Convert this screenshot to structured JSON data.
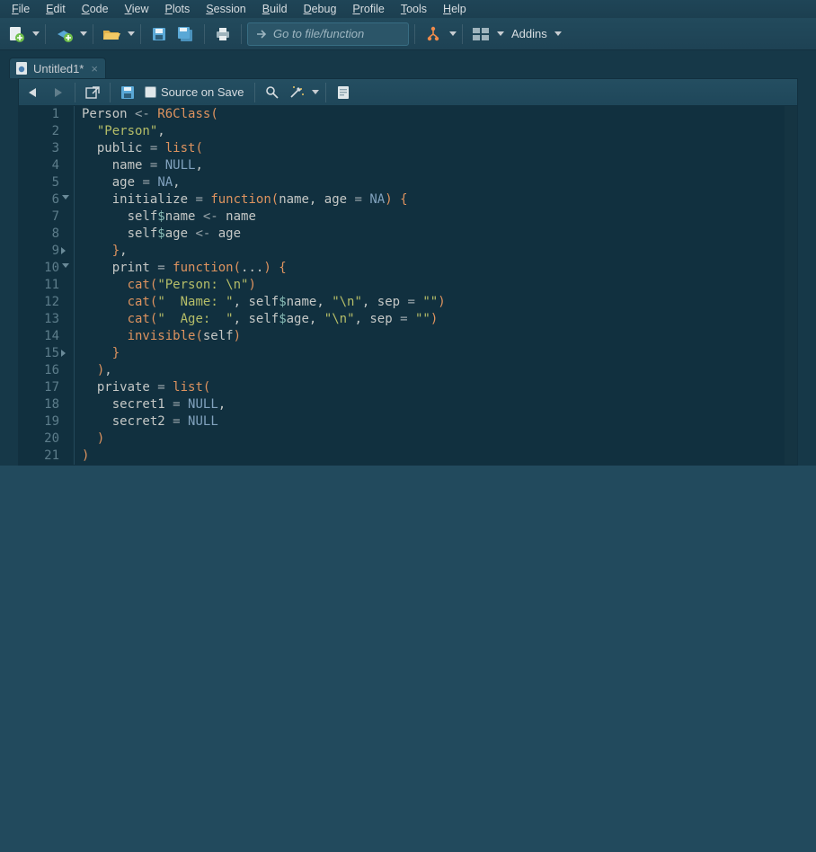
{
  "menubar": [
    {
      "label": "File",
      "ul": "F"
    },
    {
      "label": "Edit",
      "ul": "E"
    },
    {
      "label": "Code",
      "ul": "C"
    },
    {
      "label": "View",
      "ul": "V"
    },
    {
      "label": "Plots",
      "ul": "P"
    },
    {
      "label": "Session",
      "ul": "S"
    },
    {
      "label": "Build",
      "ul": "B"
    },
    {
      "label": "Debug",
      "ul": "D"
    },
    {
      "label": "Profile",
      "ul": "P"
    },
    {
      "label": "Tools",
      "ul": "T"
    },
    {
      "label": "Help",
      "ul": "H"
    }
  ],
  "toolbar": {
    "goto_placeholder": "Go to file/function",
    "addins_label": "Addins"
  },
  "tab": {
    "title": "Untitled1*"
  },
  "editor_toolbar": {
    "source_on_save": "Source on Save"
  },
  "gutter": {
    "lines": [
      1,
      2,
      3,
      4,
      5,
      6,
      7,
      8,
      9,
      10,
      11,
      12,
      13,
      14,
      15,
      16,
      17,
      18,
      19,
      20,
      21
    ],
    "fold_open_at": [
      6,
      10
    ],
    "fold_close_at": [
      9,
      15
    ]
  },
  "code": {
    "lines": [
      [
        [
          "id",
          "Person"
        ],
        [
          "op",
          " <- "
        ],
        [
          "fun",
          "R6Class"
        ],
        [
          "p",
          "("
        ]
      ],
      [
        [
          "sp",
          "  "
        ],
        [
          "str",
          "\"Person\""
        ],
        [
          "pun",
          ","
        ]
      ],
      [
        [
          "sp",
          "  "
        ],
        [
          "id",
          "public"
        ],
        [
          "op",
          " = "
        ],
        [
          "fun",
          "list"
        ],
        [
          "p",
          "("
        ]
      ],
      [
        [
          "sp",
          "    "
        ],
        [
          "id",
          "name"
        ],
        [
          "op",
          " = "
        ],
        [
          "con",
          "NULL"
        ],
        [
          "pun",
          ","
        ]
      ],
      [
        [
          "sp",
          "    "
        ],
        [
          "id",
          "age"
        ],
        [
          "op",
          " = "
        ],
        [
          "con",
          "NA"
        ],
        [
          "pun",
          ","
        ]
      ],
      [
        [
          "sp",
          "    "
        ],
        [
          "id",
          "initialize"
        ],
        [
          "op",
          " = "
        ],
        [
          "fun",
          "function"
        ],
        [
          "p",
          "("
        ],
        [
          "id",
          "name"
        ],
        [
          "pun",
          ", "
        ],
        [
          "id",
          "age"
        ],
        [
          "op",
          " = "
        ],
        [
          "con",
          "NA"
        ],
        [
          "p",
          ")"
        ],
        [
          "op",
          " "
        ],
        [
          "p",
          "{"
        ]
      ],
      [
        [
          "sp",
          "      "
        ],
        [
          "id",
          "self"
        ],
        [
          "dollar",
          "$"
        ],
        [
          "id",
          "name"
        ],
        [
          "op",
          " <- "
        ],
        [
          "id",
          "name"
        ]
      ],
      [
        [
          "sp",
          "      "
        ],
        [
          "id",
          "self"
        ],
        [
          "dollar",
          "$"
        ],
        [
          "id",
          "age"
        ],
        [
          "op",
          " <- "
        ],
        [
          "id",
          "age"
        ]
      ],
      [
        [
          "sp",
          "    "
        ],
        [
          "p",
          "}"
        ],
        [
          "pun",
          ","
        ]
      ],
      [
        [
          "sp",
          "    "
        ],
        [
          "id",
          "print"
        ],
        [
          "op",
          " = "
        ],
        [
          "fun",
          "function"
        ],
        [
          "p",
          "("
        ],
        [
          "id",
          "..."
        ],
        [
          "p",
          ")"
        ],
        [
          "op",
          " "
        ],
        [
          "p",
          "{"
        ]
      ],
      [
        [
          "sp",
          "      "
        ],
        [
          "fun",
          "cat"
        ],
        [
          "p",
          "("
        ],
        [
          "str",
          "\"Person: \\n\""
        ],
        [
          "p",
          ")"
        ]
      ],
      [
        [
          "sp",
          "      "
        ],
        [
          "fun",
          "cat"
        ],
        [
          "p",
          "("
        ],
        [
          "str",
          "\"  Name: \""
        ],
        [
          "pun",
          ", "
        ],
        [
          "id",
          "self"
        ],
        [
          "dollar",
          "$"
        ],
        [
          "id",
          "name"
        ],
        [
          "pun",
          ", "
        ],
        [
          "str",
          "\"\\n\""
        ],
        [
          "pun",
          ", "
        ],
        [
          "id",
          "sep"
        ],
        [
          "op",
          " = "
        ],
        [
          "str",
          "\"\""
        ],
        [
          "p",
          ")"
        ]
      ],
      [
        [
          "sp",
          "      "
        ],
        [
          "fun",
          "cat"
        ],
        [
          "p",
          "("
        ],
        [
          "str",
          "\"  Age:  \""
        ],
        [
          "pun",
          ", "
        ],
        [
          "id",
          "self"
        ],
        [
          "dollar",
          "$"
        ],
        [
          "id",
          "age"
        ],
        [
          "pun",
          ", "
        ],
        [
          "str",
          "\"\\n\""
        ],
        [
          "pun",
          ", "
        ],
        [
          "id",
          "sep"
        ],
        [
          "op",
          " = "
        ],
        [
          "str",
          "\"\""
        ],
        [
          "p",
          ")"
        ]
      ],
      [
        [
          "sp",
          "      "
        ],
        [
          "fun",
          "invisible"
        ],
        [
          "p",
          "("
        ],
        [
          "id",
          "self"
        ],
        [
          "p",
          ")"
        ]
      ],
      [
        [
          "sp",
          "    "
        ],
        [
          "p",
          "}"
        ]
      ],
      [
        [
          "sp",
          "  "
        ],
        [
          "p",
          ")"
        ],
        [
          "pun",
          ","
        ]
      ],
      [
        [
          "sp",
          "  "
        ],
        [
          "id",
          "private"
        ],
        [
          "op",
          " = "
        ],
        [
          "fun",
          "list"
        ],
        [
          "p",
          "("
        ]
      ],
      [
        [
          "sp",
          "    "
        ],
        [
          "id",
          "secret1"
        ],
        [
          "op",
          " = "
        ],
        [
          "con",
          "NULL"
        ],
        [
          "pun",
          ","
        ]
      ],
      [
        [
          "sp",
          "    "
        ],
        [
          "id",
          "secret2"
        ],
        [
          "op",
          " = "
        ],
        [
          "con",
          "NULL"
        ]
      ],
      [
        [
          "sp",
          "  "
        ],
        [
          "p",
          ")"
        ]
      ],
      [
        [
          "p",
          ")"
        ]
      ]
    ]
  },
  "icons": {
    "new_file": "new-file-icon",
    "new_project": "new-project-icon",
    "open": "open-folder-icon",
    "save": "save-icon",
    "save_all": "save-all-icon",
    "print": "print-icon",
    "goto": "goto-arrow-icon",
    "git": "git-icon",
    "panes": "panes-icon",
    "back": "back-icon",
    "forward": "forward-icon",
    "popout": "popout-icon",
    "save_ed": "save-icon",
    "checkbox": "checkbox-icon",
    "find": "search-icon",
    "wand": "wand-icon",
    "compile": "document-icon",
    "file": "r-file-icon"
  },
  "colors": {
    "bg": "#11303f",
    "panel": "#234d60",
    "accent": "#de935f",
    "string": "#b5bd68",
    "constant": "#81a2be",
    "gutter": "#5d7d8b"
  }
}
